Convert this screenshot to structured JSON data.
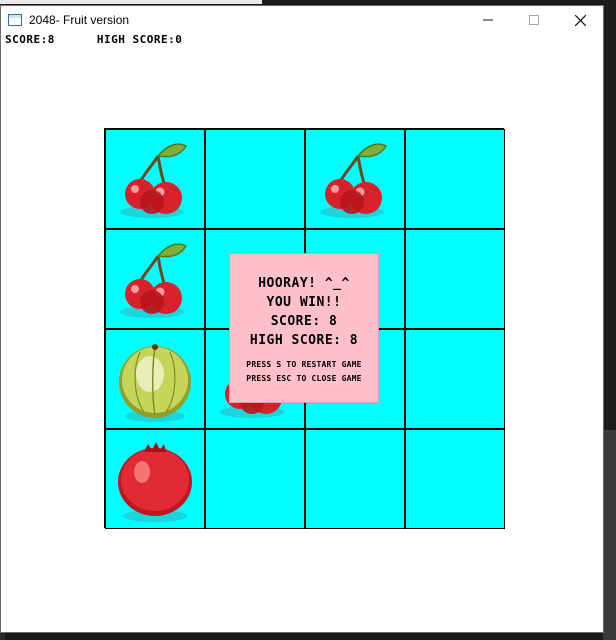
{
  "window": {
    "title": "2048- Fruit version",
    "controls": {
      "minimize": "minimize-icon",
      "maximize": "maximize-icon",
      "close": "close-icon"
    }
  },
  "scores": {
    "score_text": "SCORE:8",
    "high_score_text": "HIGH SCORE:0"
  },
  "board": {
    "size": 4,
    "background_color": "#00ffff",
    "grid_color": "#000000",
    "tiles": [
      [
        "cherry",
        "",
        "cherry",
        ""
      ],
      [
        "cherry",
        "",
        "",
        ""
      ],
      [
        "gooseberry",
        "cherry",
        "",
        ""
      ],
      [
        "cranberry",
        "",
        "",
        ""
      ]
    ]
  },
  "overlay": {
    "background_color": "#ffc0cb",
    "line1": "HOORAY! ^_^",
    "line2": "YOU WIN!!",
    "line3": "SCORE: 8",
    "line4": "HIGH SCORE: 8",
    "instruction1": "PRESS S TO RESTART GAME",
    "instruction2": "PRESS ESC TO CLOSE GAME"
  }
}
